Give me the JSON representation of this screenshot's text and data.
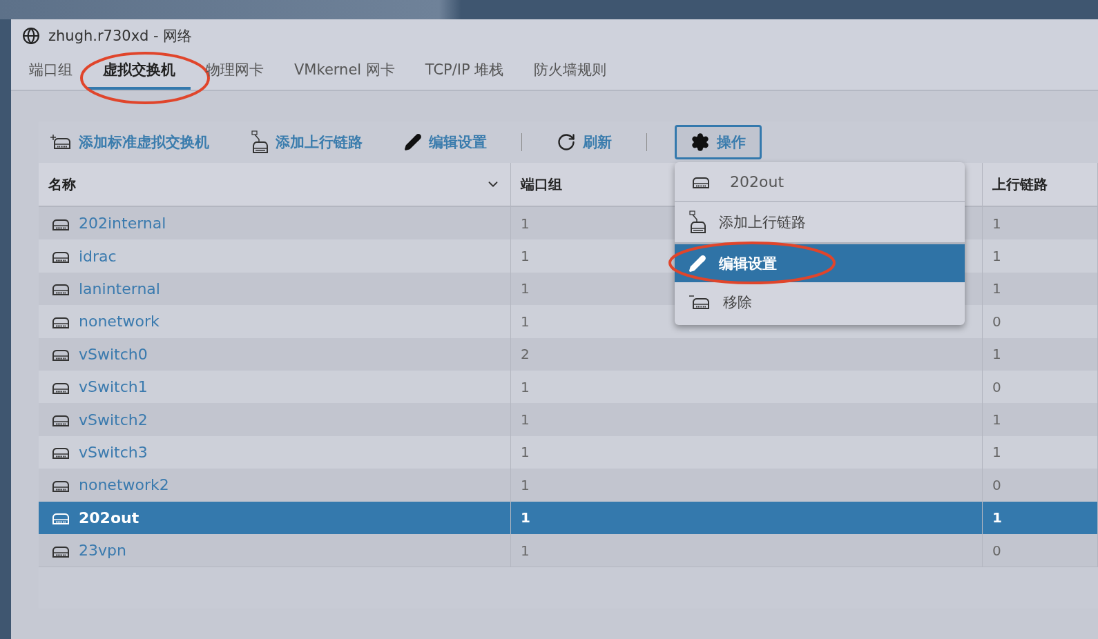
{
  "window": {
    "title": "zhugh.r730xd - 网络"
  },
  "tabs": [
    {
      "label": "端口组",
      "selected": false
    },
    {
      "label": "虚拟交换机",
      "selected": true
    },
    {
      "label": "物理网卡",
      "selected": false
    },
    {
      "label": "VMkernel 网卡",
      "selected": false
    },
    {
      "label": "TCP/IP 堆栈",
      "selected": false
    },
    {
      "label": "防火墙规则",
      "selected": false
    }
  ],
  "toolbar": [
    {
      "kind": "add-switch",
      "label": "添加标准虚拟交换机"
    },
    {
      "kind": "add-uplink",
      "label": "添加上行链路"
    },
    {
      "kind": "edit",
      "label": "编辑设置"
    },
    {
      "kind": "refresh",
      "label": "刷新"
    },
    {
      "kind": "actions",
      "label": "操作",
      "open": true
    }
  ],
  "actions_menu": {
    "title": "202out",
    "items": [
      {
        "kind": "add-uplink",
        "label": "添加上行链路",
        "selected": false
      },
      {
        "kind": "edit",
        "label": "编辑设置",
        "selected": true
      },
      {
        "kind": "remove",
        "label": "移除",
        "selected": false
      }
    ]
  },
  "table": {
    "columns": [
      "名称",
      "端口组",
      "上行链路"
    ],
    "rows": [
      {
        "name": "202internal",
        "port_groups": "1",
        "uplinks": "1",
        "selected": false
      },
      {
        "name": "idrac",
        "port_groups": "1",
        "uplinks": "1",
        "selected": false
      },
      {
        "name": "laninternal",
        "port_groups": "1",
        "uplinks": "1",
        "selected": false
      },
      {
        "name": "nonetwork",
        "port_groups": "1",
        "uplinks": "0",
        "selected": false
      },
      {
        "name": "vSwitch0",
        "port_groups": "2",
        "uplinks": "1",
        "selected": false
      },
      {
        "name": "vSwitch1",
        "port_groups": "1",
        "uplinks": "0",
        "selected": false
      },
      {
        "name": "vSwitch2",
        "port_groups": "1",
        "uplinks": "1",
        "selected": false
      },
      {
        "name": "vSwitch3",
        "port_groups": "1",
        "uplinks": "1",
        "selected": false
      },
      {
        "name": "nonetwork2",
        "port_groups": "1",
        "uplinks": "0",
        "selected": false
      },
      {
        "name": "202out",
        "port_groups": "1",
        "uplinks": "1",
        "selected": true
      },
      {
        "name": "23vpn",
        "port_groups": "1",
        "uplinks": "0",
        "selected": false
      }
    ]
  }
}
